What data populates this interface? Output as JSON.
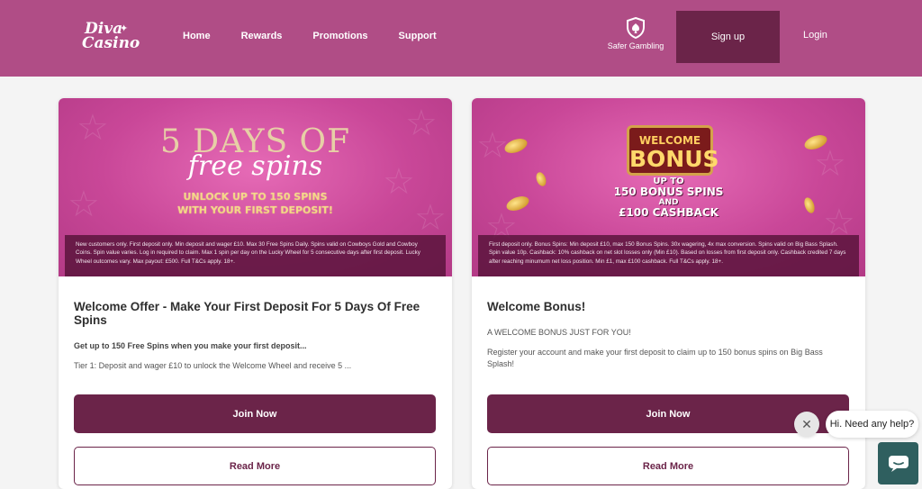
{
  "brand": {
    "line1": "Diva",
    "line2": "Casino"
  },
  "nav": {
    "home": "Home",
    "rewards": "Rewards",
    "promotions": "Promotions",
    "support": "Support"
  },
  "header": {
    "safer_gambling": "Safer Gambling",
    "signup": "Sign up",
    "login": "Login"
  },
  "cards": [
    {
      "banner": {
        "title_line1": "5 DAYS OF",
        "title_line2": "free spins",
        "subtitle_line1": "UNLOCK UP TO 150 SPINS",
        "subtitle_line2": "WITH YOUR FIRST DEPOSIT!",
        "terms": "New customers only. First deposit only. Min deposit and wager £10. Max 30 Free Spins Daily. Spins valid on Cowboys Gold and Cowboy Coins. Spin value varies. Log in required to claim. Max 1 spin per day on the Lucky Wheel for 5 consecutive days after first deposit. Lucky Wheel outcomes vary. Max payout: £500. Full T&Cs apply. 18+."
      },
      "title": "Welcome Offer - Make Your First Deposit For 5 Days Of Free Spins",
      "desc1": "Get up to 150 Free Spins when you make your first deposit...",
      "desc2": "Tier 1: Deposit and wager £10 to unlock the Welcome Wheel and receive 5 ...",
      "join_label": "Join Now",
      "more_label": "Read More"
    },
    {
      "banner": {
        "welcome": "WELCOME",
        "bonus": "BONUS",
        "line1": "UP TO",
        "line2": "150 BONUS SPINS",
        "line3": "AND",
        "line4": "£100 CASHBACK",
        "terms": "First deposit only. Bonus Spins: Min deposit £10, max 150 Bonus Spins. 30x wagering, 4x max conversion. Spins valid on Big Bass Splash. Spin value 10p. Cashback: 10% cashback on net slot losses only (Min £10). Based on losses from first deposit only. Cashback credited 7 days after reaching minumum net loss position. Min £1, max £100 cashback. Full T&Cs apply. 18+."
      },
      "title": "Welcome Bonus!",
      "desc1": "A WELCOME BONUS JUST FOR YOU!",
      "desc2": "Register your account and make your first deposit to claim up to 150 bonus spins on Big Bass Splash!",
      "join_label": "Join Now",
      "more_label": "Read More"
    }
  ],
  "chat": {
    "greeting": "Hi. Need any help?",
    "close_icon": "close-icon",
    "launcher_icon": "chat-icon"
  },
  "colors": {
    "header_bg": "#b04d86",
    "primary": "#6b2449",
    "chat": "#2f5f5f"
  }
}
